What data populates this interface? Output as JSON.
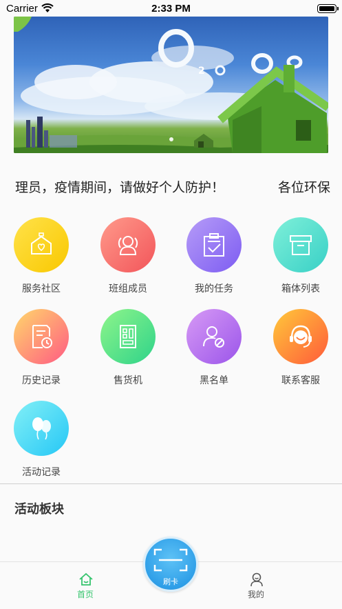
{
  "status_bar": {
    "carrier": "Carrier",
    "time": "2:33 PM"
  },
  "banner": {
    "slides": 1,
    "active_dot": 0
  },
  "notice": {
    "text": "理员，疫情期间，请做好个人防护！",
    "text_continued": "各位环保"
  },
  "grid": {
    "items": [
      {
        "label": "服务社区",
        "icon": "community-house-icon",
        "from": "#ffe24a",
        "to": "#f9c800"
      },
      {
        "label": "班组成员",
        "icon": "team-members-icon",
        "from": "#ff9a8b",
        "to": "#f2555a"
      },
      {
        "label": "我的任务",
        "icon": "task-clipboard-icon",
        "from": "#b69cf7",
        "to": "#7d5cf2"
      },
      {
        "label": "箱体列表",
        "icon": "box-archive-icon",
        "from": "#7ff0d9",
        "to": "#38d0c6"
      },
      {
        "label": "历史记录",
        "icon": "history-record-icon",
        "from": "#ffd86b",
        "to": "#ff5a83"
      },
      {
        "label": "售货机",
        "icon": "vending-machine-icon",
        "from": "#8ff58a",
        "to": "#2ed38a"
      },
      {
        "label": "黑名单",
        "icon": "blacklist-user-icon",
        "from": "#d79af5",
        "to": "#9b55ea"
      },
      {
        "label": "联系客服",
        "icon": "customer-service-icon",
        "from": "#ffc93a",
        "to": "#ff5a3a"
      },
      {
        "label": "活动记录",
        "icon": "balloons-icon",
        "from": "#83f0f7",
        "to": "#25c7f5"
      }
    ]
  },
  "section": {
    "title": "活动板块"
  },
  "tabbar": {
    "home_label": "首页",
    "scan_label": "刷卡",
    "mine_label": "我的",
    "active_color": "#35c46d",
    "inactive_color": "#555555"
  }
}
